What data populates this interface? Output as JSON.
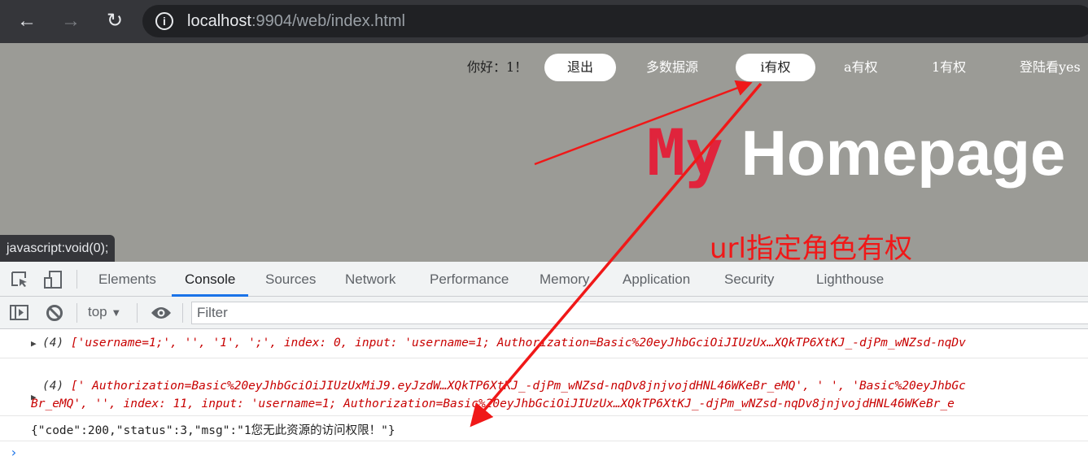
{
  "browser": {
    "url_host": "localhost",
    "url_rest": ":9904/web/index.html",
    "back": "←",
    "forward": "→",
    "reload": "↻"
  },
  "page": {
    "greeting": "你好：1！",
    "menu": [
      {
        "label": "退出"
      },
      {
        "label": "多数据源"
      },
      {
        "label": "i有权"
      },
      {
        "label": "a有权"
      },
      {
        "label": "1有权"
      },
      {
        "label": "登陆看yes"
      }
    ],
    "title_my": "My",
    "title_rest": "Homepage",
    "status_text": "javascript:void(0);"
  },
  "annotation": {
    "text": "url指定角色有权",
    "color": "#f01818"
  },
  "devtools": {
    "tabs": [
      "Elements",
      "Console",
      "Sources",
      "Network",
      "Performance",
      "Memory",
      "Application",
      "Security",
      "Lighthouse"
    ],
    "active_tab": "Console",
    "context": "top",
    "filter_placeholder": "Filter",
    "logs": [
      {
        "count": "(4)",
        "text": "['username=1;', '', '1', ';', index: 0, input: 'username=1; Authorization=Basic%20eyJhbGciOiJIUzUx…XQkTP6XtKJ_-djPm_wNZsd-nqDv"
      },
      {
        "count": "(4)",
        "line1": "[' Authorization=Basic%20eyJhbGciOiJIUzUxMiJ9.eyJzdW…XQkTP6XtKJ_-djPm_wNZsd-nqDv8jnjvojdHNL46WKeBr_eMQ', ' ', 'Basic%20eyJhbGc",
        "line2": "Br_eMQ', '', index: 11, input: 'username=1; Authorization=Basic%20eyJhbGciOiJIUzUx…XQkTP6XtKJ_-djPm_wNZsd-nqDv8jnjvojdHNL46WKeBr_e"
      },
      {
        "text": "{\"code\":200,\"status\":3,\"msg\":\"1您无此资源的访问权限！\"}"
      }
    ],
    "prompt": "›"
  }
}
